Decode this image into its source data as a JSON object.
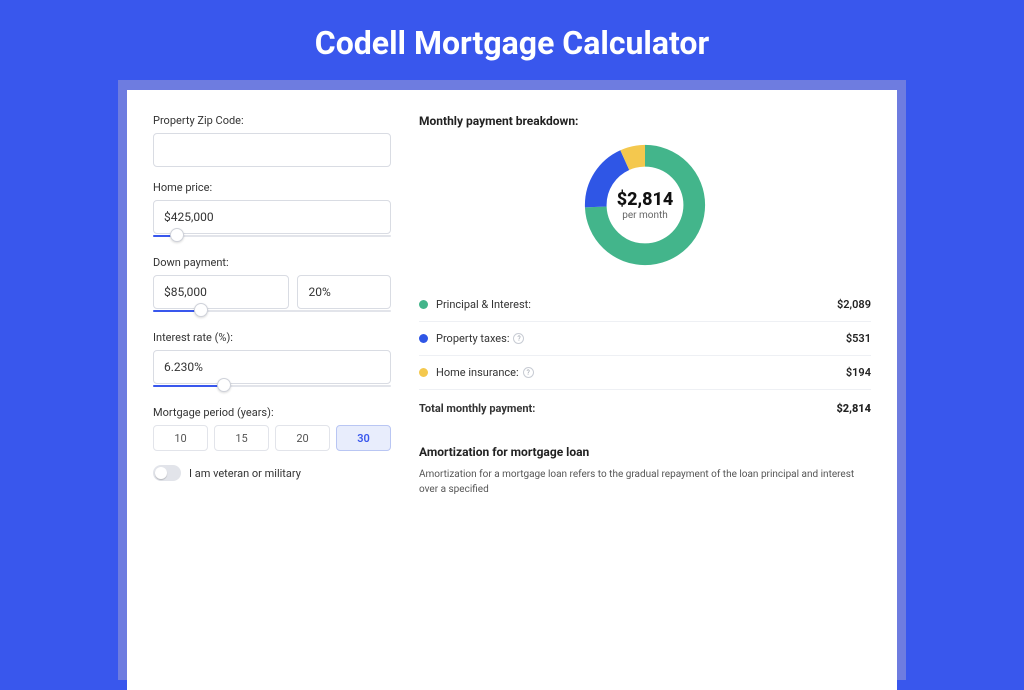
{
  "title": "Codell Mortgage Calculator",
  "form": {
    "zip_label": "Property Zip Code:",
    "zip_value": "",
    "home_price_label": "Home price:",
    "home_price_value": "$425,000",
    "down_payment_label": "Down payment:",
    "down_payment_value": "$85,000",
    "down_payment_pct": "20%",
    "interest_rate_label": "Interest rate (%):",
    "interest_rate_value": "6.230%",
    "mortgage_period_label": "Mortgage period (years):",
    "period_options": [
      "10",
      "15",
      "20",
      "30"
    ],
    "period_selected": "30",
    "veteran_label": "I am veteran or military"
  },
  "breakdown": {
    "heading": "Monthly payment breakdown:",
    "center_amount": "$2,814",
    "center_sub": "per month",
    "rows": [
      {
        "label": "Principal & Interest:",
        "value": "$2,089",
        "color": "#43B58B",
        "info": false
      },
      {
        "label": "Property taxes:",
        "value": "$531",
        "color": "#2F56E6",
        "info": true
      },
      {
        "label": "Home insurance:",
        "value": "$194",
        "color": "#F4C84E",
        "info": true
      }
    ],
    "total_label": "Total monthly payment:",
    "total_value": "$2,814"
  },
  "amortization": {
    "heading": "Amortization for mortgage loan",
    "text": "Amortization for a mortgage loan refers to the gradual repayment of the loan principal and interest over a specified"
  },
  "chart_data": {
    "type": "pie",
    "title": "Monthly payment breakdown",
    "categories": [
      "Principal & Interest",
      "Property taxes",
      "Home insurance"
    ],
    "values": [
      2089,
      531,
      194
    ],
    "total": 2814,
    "colors": [
      "#43B58B",
      "#2F56E6",
      "#F4C84E"
    ]
  },
  "sliders": {
    "home_price_fill_pct": 10,
    "down_payment_fill_pct": 20,
    "interest_rate_fill_pct": 30
  }
}
